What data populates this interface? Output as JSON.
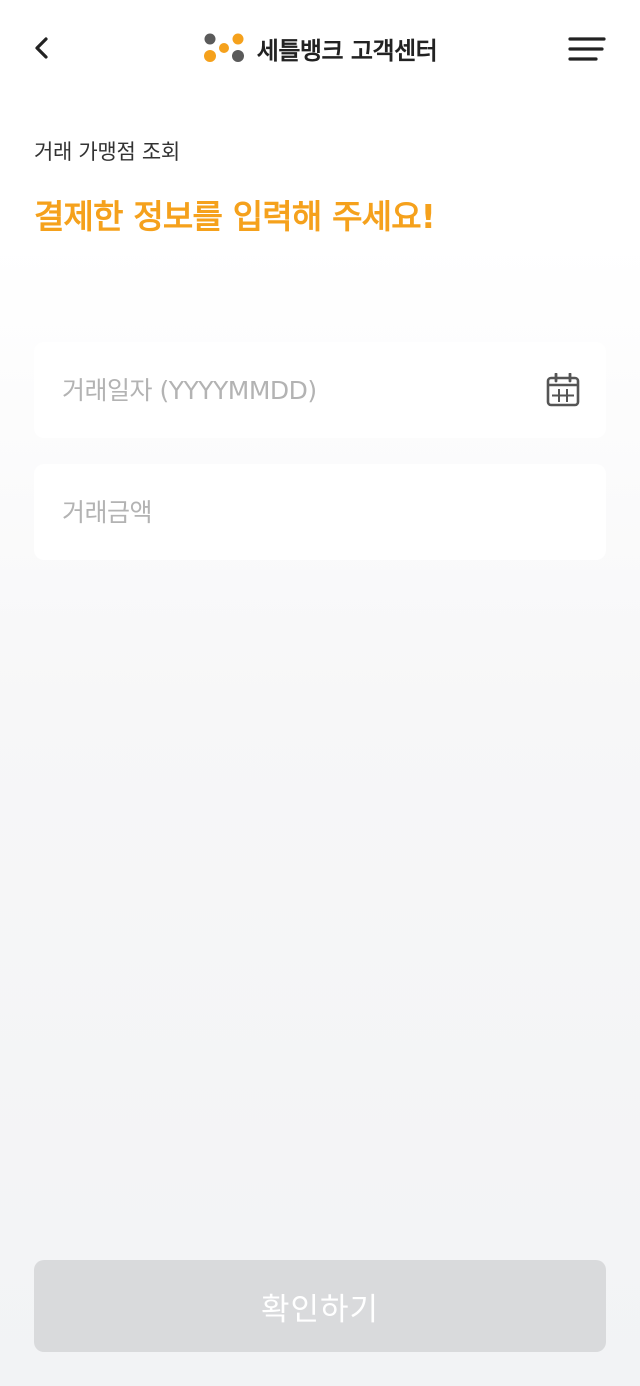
{
  "header": {
    "title": "세틀뱅크 고객센터",
    "icons": {
      "back": "chevron-left-icon",
      "logo": "settlebank-logo",
      "menu": "hamburger-menu-icon"
    }
  },
  "page": {
    "subtitle": "거래 가맹점 조회",
    "headline": "결제한 정보를 입력해 주세요!"
  },
  "form": {
    "date": {
      "placeholder": "거래일자 (YYYYMMDD)",
      "value": "",
      "icon": "calendar-icon"
    },
    "amount": {
      "placeholder": "거래금액",
      "value": ""
    }
  },
  "footer": {
    "confirm_label": "확인하기"
  },
  "colors": {
    "accent": "#f5a11c",
    "logo_gray": "#5a5a5a",
    "button_disabled": "#d9dadc",
    "placeholder": "#b3b3b3"
  }
}
